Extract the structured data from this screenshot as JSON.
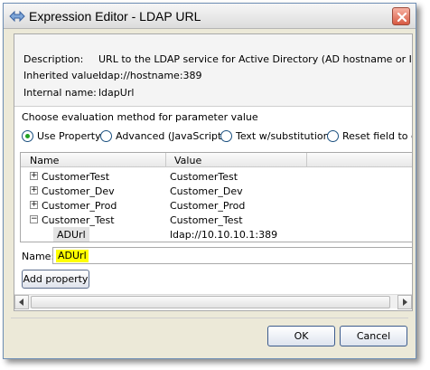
{
  "window": {
    "title": "Expression Editor - LDAP URL",
    "icon": "expression-editor-icon"
  },
  "info": {
    "description_label": "Description:",
    "description_value": "URL to the LDAP service for Active Directory (AD hostname or IP addres",
    "inherited_label": "Inherited value:",
    "inherited_value": "ldap://hostname:389",
    "internal_label": "Internal name:",
    "internal_value": "ldapUrl"
  },
  "method": {
    "prompt": "Choose evaluation method for parameter value",
    "options": [
      {
        "label": "Use Property",
        "selected": true
      },
      {
        "label": "Advanced (JavaScript)",
        "selected": false
      },
      {
        "label": "Text w/substitution",
        "selected": false
      },
      {
        "label": "Reset field to de",
        "selected": false
      }
    ]
  },
  "tree": {
    "columns": [
      "Name",
      "Value"
    ],
    "rows": [
      {
        "name": "CustomerTest",
        "value": "CustomerTest",
        "toggle": "+"
      },
      {
        "name": "Customer_Dev",
        "value": "Customer_Dev",
        "toggle": "+"
      },
      {
        "name": "Customer_Prod",
        "value": "Customer_Prod",
        "toggle": "+"
      },
      {
        "name": "Customer_Test",
        "value": "Customer_Test",
        "toggle": "−"
      },
      {
        "name": "ADUrl",
        "value": "ldap://10.10.10.1:389",
        "toggle": ""
      }
    ]
  },
  "name_field": {
    "label": "Name:",
    "value": "ADUrl"
  },
  "buttons": {
    "add_property": "Add property",
    "ok": "OK",
    "cancel": "Cancel"
  },
  "colors": {
    "highlight": "#ffff00",
    "radio_selected": "#21a121",
    "close_button": "#d75a42"
  }
}
